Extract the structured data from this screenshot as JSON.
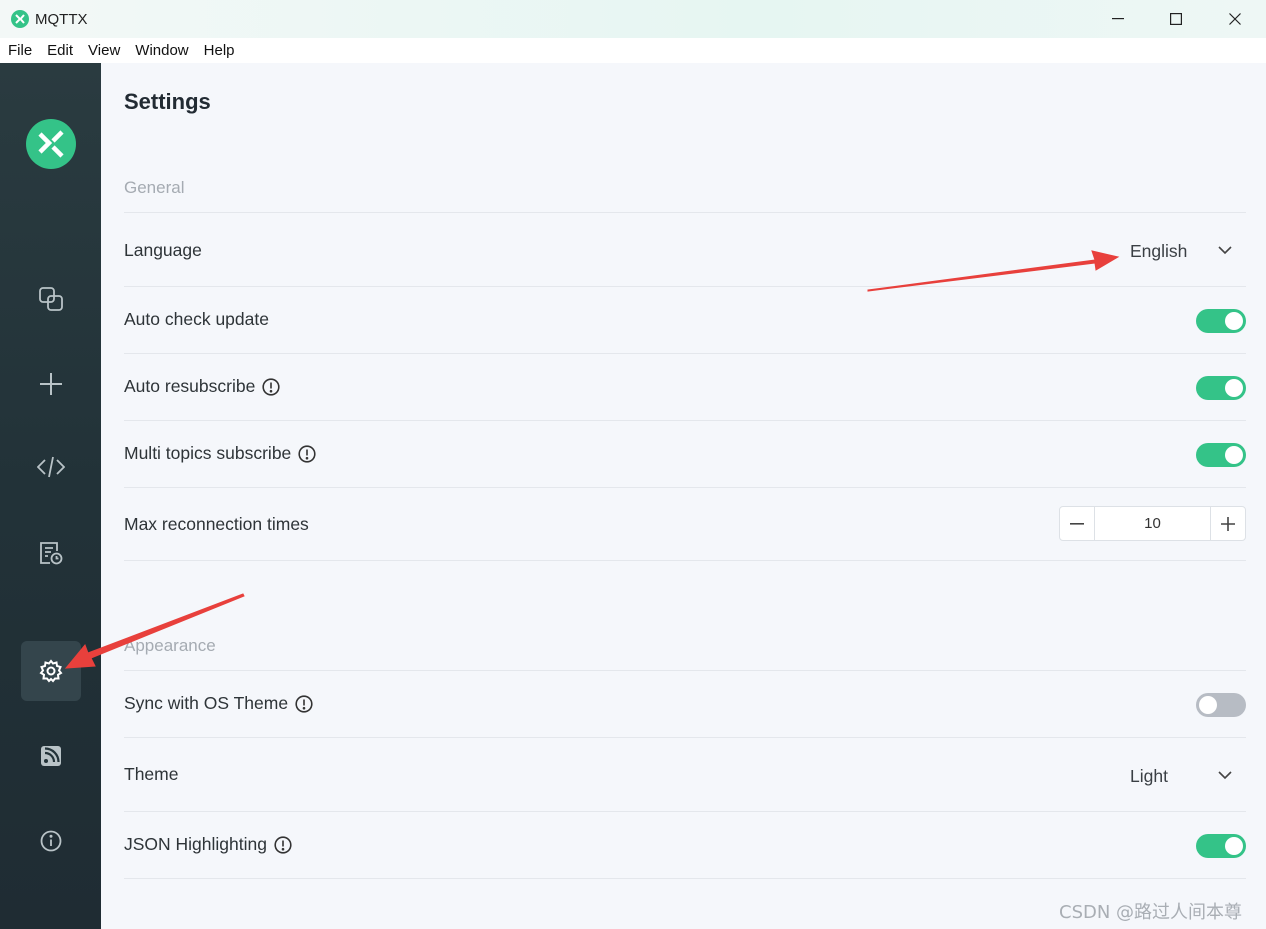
{
  "window": {
    "title": "MQTTX",
    "controls": [
      "minimize",
      "maximize",
      "close"
    ]
  },
  "menu": [
    "File",
    "Edit",
    "View",
    "Window",
    "Help"
  ],
  "sidebar": {
    "items": [
      {
        "icon": "connections-icon",
        "active": false
      },
      {
        "icon": "plus-icon",
        "active": false
      },
      {
        "icon": "code-icon",
        "active": false
      },
      {
        "icon": "log-icon",
        "active": false
      },
      {
        "icon": "gear-icon",
        "active": true
      },
      {
        "icon": "feed-icon",
        "active": false
      },
      {
        "icon": "info-icon",
        "active": false
      }
    ]
  },
  "settings": {
    "title": "Settings",
    "general": {
      "section": "General",
      "language_label": "Language",
      "language_value": "English",
      "auto_check_update_label": "Auto check update",
      "auto_check_update": true,
      "auto_resubscribe_label": "Auto resubscribe",
      "auto_resubscribe": true,
      "multi_topics_label": "Multi topics subscribe",
      "multi_topics": true,
      "max_reconnect_label": "Max reconnection times",
      "max_reconnect_value": "10"
    },
    "appearance": {
      "section": "Appearance",
      "sync_os_theme_label": "Sync with OS Theme",
      "sync_os_theme": false,
      "theme_label": "Theme",
      "theme_value": "Light",
      "json_highlighting_label": "JSON Highlighting",
      "json_highlighting": true
    }
  },
  "colors": {
    "accent": "#34c388",
    "annotation_arrow": "#e8403c",
    "sidebar_bg": "#223238"
  },
  "watermark": "CSDN @路过人间本尊"
}
